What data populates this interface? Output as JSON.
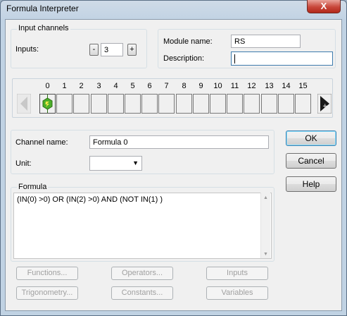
{
  "window": {
    "title": "Formula Interpreter",
    "close_label": "X"
  },
  "input_channels": {
    "title": "Input channels",
    "inputs_label": "Inputs:",
    "minus_label": "-",
    "count": "3",
    "plus_label": "+"
  },
  "module": {
    "name_label": "Module name:",
    "name_value": "RS",
    "description_label": "Description:",
    "description_value": ""
  },
  "channels": {
    "numbers": [
      "0",
      "1",
      "2",
      "3",
      "4",
      "5",
      "6",
      "7",
      "8",
      "9",
      "10",
      "11",
      "12",
      "13",
      "14",
      "15"
    ],
    "active_index": 0,
    "active_color": "#4caf2a"
  },
  "channel": {
    "name_label": "Channel name:",
    "name_value": "Formula 0",
    "unit_label": "Unit:",
    "unit_value": ""
  },
  "formula": {
    "title": "Formula",
    "text": "(IN(0) >0) OR (IN(2) >0) AND (NOT IN(1) )"
  },
  "buttons": {
    "ok": "OK",
    "cancel": "Cancel",
    "help": "Help",
    "functions": "Functions...",
    "operators": "Operators...",
    "inputs": "Inputs",
    "trigonometry": "Trigonometry...",
    "constants": "Constants...",
    "variables": "Variables"
  }
}
